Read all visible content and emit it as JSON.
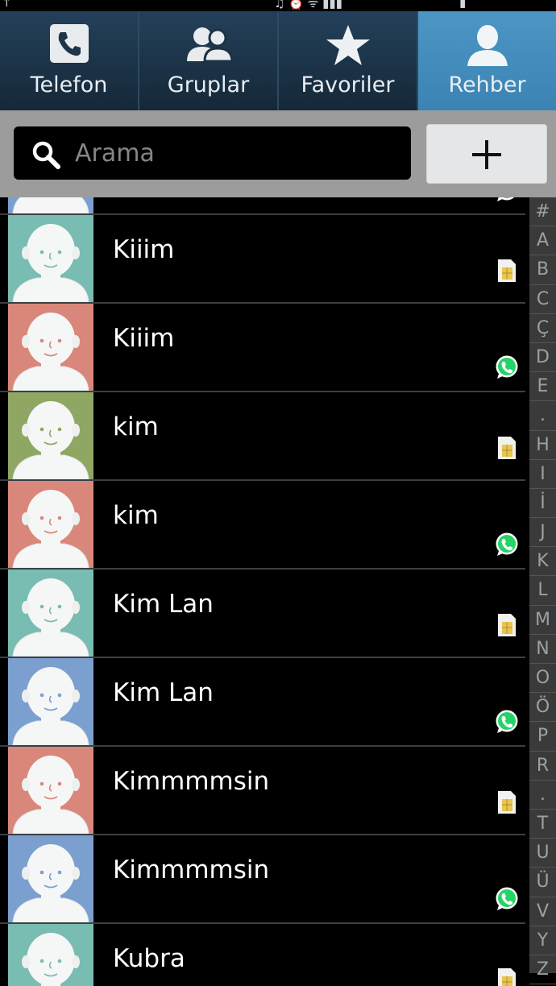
{
  "tabs": [
    {
      "label": "Telefon",
      "icon": "phone-icon",
      "active": false
    },
    {
      "label": "Gruplar",
      "icon": "groups-icon",
      "active": false
    },
    {
      "label": "Favoriler",
      "icon": "star-icon",
      "active": false
    },
    {
      "label": "Rehber",
      "icon": "contact-icon",
      "active": true
    }
  ],
  "search": {
    "placeholder": "Arama"
  },
  "contacts": [
    {
      "name": "",
      "color": "#7b9fcf",
      "source": "whatsapp"
    },
    {
      "name": "Kiiim",
      "color": "#79bcb2",
      "source": "sim"
    },
    {
      "name": "Kiiim",
      "color": "#d9877a",
      "source": "whatsapp"
    },
    {
      "name": "kim",
      "color": "#8fa763",
      "source": "sim"
    },
    {
      "name": "kim",
      "color": "#d9877a",
      "source": "whatsapp"
    },
    {
      "name": "Kim Lan",
      "color": "#79bcb2",
      "source": "sim"
    },
    {
      "name": "Kim Lan",
      "color": "#7b9fcf",
      "source": "whatsapp"
    },
    {
      "name": "Kimmmmsin",
      "color": "#d9877a",
      "source": "sim"
    },
    {
      "name": "Kimmmmsin",
      "color": "#7b9fcf",
      "source": "whatsapp"
    },
    {
      "name": "Kubra",
      "color": "#79bcb2",
      "source": "sim"
    }
  ],
  "index_letters": [
    "#",
    "A",
    "B",
    "C",
    "Ç",
    "D",
    "E",
    ".",
    "H",
    "I",
    "İ",
    "J",
    "K",
    "L",
    "M",
    "N",
    "O",
    "Ö",
    "P",
    "R",
    ".",
    "T",
    "U",
    "Ü",
    "V",
    "Y",
    "Z"
  ],
  "colors": {
    "tab_active": "#4a92c2",
    "tab_bg": "#1d3344",
    "whatsapp": "#25d366",
    "sim": "#e8c650"
  }
}
